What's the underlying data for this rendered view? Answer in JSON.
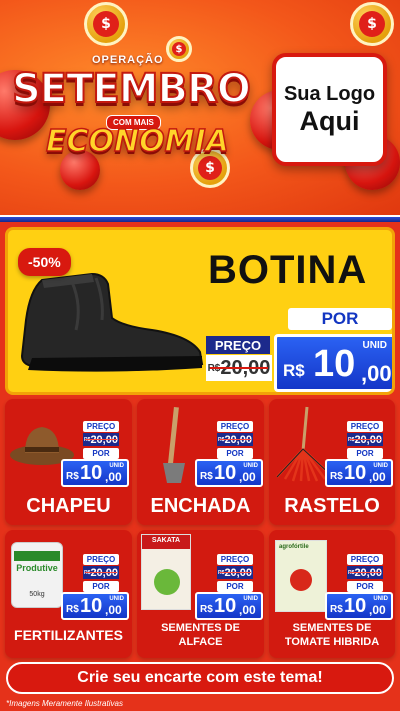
{
  "header": {
    "operation_label": "OPERAÇÃO",
    "title": "SETEMBRO",
    "subtitle_small": "COM MAIS",
    "subtitle": "ECONOMIA",
    "logo_line1": "Sua Logo",
    "logo_line2": "Aqui",
    "coin_symbol": "$"
  },
  "hero": {
    "badge": "-50%",
    "product": "BOTINA",
    "price_label": "PREÇO",
    "old_currency": "R$",
    "old_price": "20,00",
    "por_label": "POR",
    "unit_label": "UNID",
    "new_currency": "R$",
    "new_integer": "10",
    "new_cents": ",00"
  },
  "small_price": {
    "price_label": "PREÇO",
    "old_currency": "R$",
    "old_price": "20,00",
    "por_label": "POR",
    "unit_label": "UNID",
    "new_currency": "R$",
    "new_integer": "10",
    "new_cents": ",00"
  },
  "products": [
    {
      "name": "CHAPEU"
    },
    {
      "name": "ENCHADA"
    },
    {
      "name": "RASTELO"
    },
    {
      "name": "FERTILIZANTES",
      "package_text": "Produtive",
      "package_sub": "50kg"
    },
    {
      "name_line1": "SEMENTES DE",
      "name_line2": "ALFACE",
      "package_text": "SAKATA"
    },
    {
      "name_line1": "SEMENTES DE",
      "name_line2": "TOMATE HIBRIDA",
      "package_text": "agrofórtile"
    }
  ],
  "cta": "Crie seu encarte com este tema!",
  "footnote": "*Imagens Meramente Ilustrativas",
  "colors": {
    "primary_red": "#d21a10",
    "accent_yellow": "#ffd012",
    "price_blue": "#1436c8",
    "dark_navy": "#1c2a8c"
  }
}
